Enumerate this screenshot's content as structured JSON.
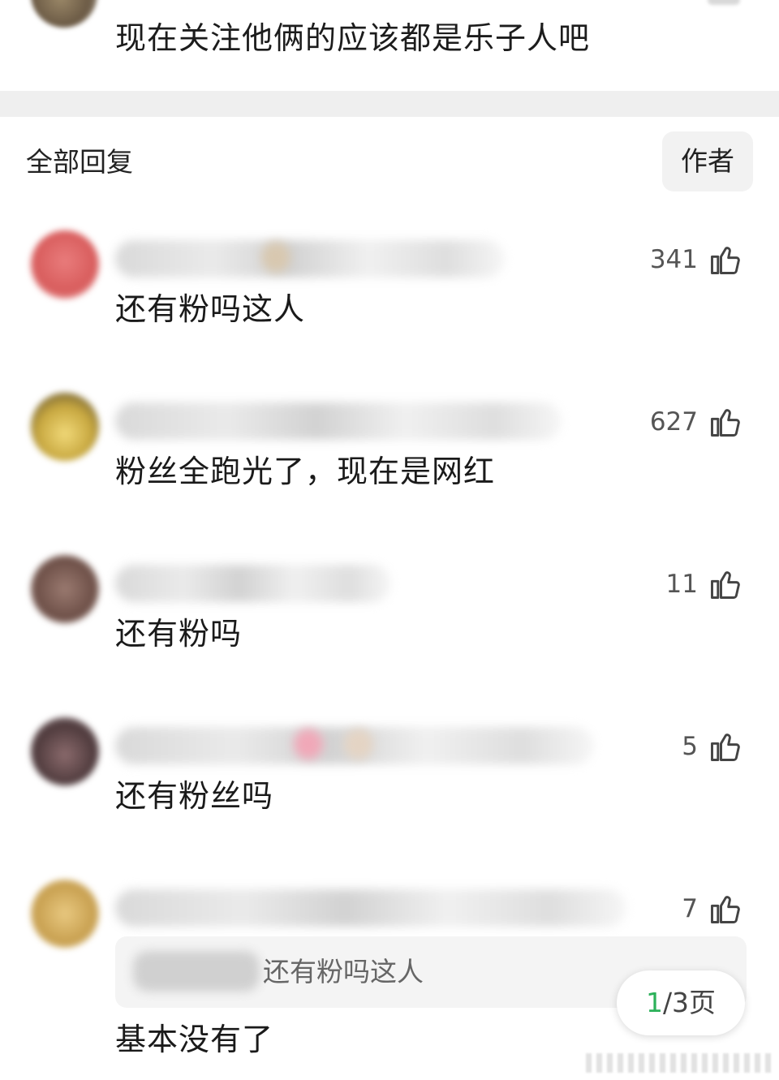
{
  "top_comment": {
    "text": "现在关注他俩的应该都是乐子人吧"
  },
  "replies_header": {
    "title": "全部回复",
    "author_filter": "作者"
  },
  "replies": [
    {
      "likes": "341",
      "text": "还有粉吗这人",
      "avatar_color": "#e06a6a",
      "name_accent": "#d8c8b0"
    },
    {
      "likes": "627",
      "text": "粉丝全跑光了，现在是网红",
      "avatar_color": "#d8c060",
      "name_accent": ""
    },
    {
      "likes": "11",
      "text": "还有粉吗",
      "avatar_color": "#8a6d62",
      "name_accent": ""
    },
    {
      "likes": "5",
      "text": "还有粉丝吗",
      "avatar_color": "#6f5558",
      "name_accent": "#f0a8b8"
    },
    {
      "likes": "7",
      "text": "基本没有了",
      "avatar_color": "#d8b870",
      "name_accent": "",
      "quoted_text": "还有粉吗这人"
    }
  ],
  "pagination": {
    "current": "1",
    "rest": "/3页"
  },
  "colors": {
    "accent": "#2cb15a",
    "divider": "#efefef"
  },
  "icons": {
    "like": "thumbs-up-icon"
  }
}
